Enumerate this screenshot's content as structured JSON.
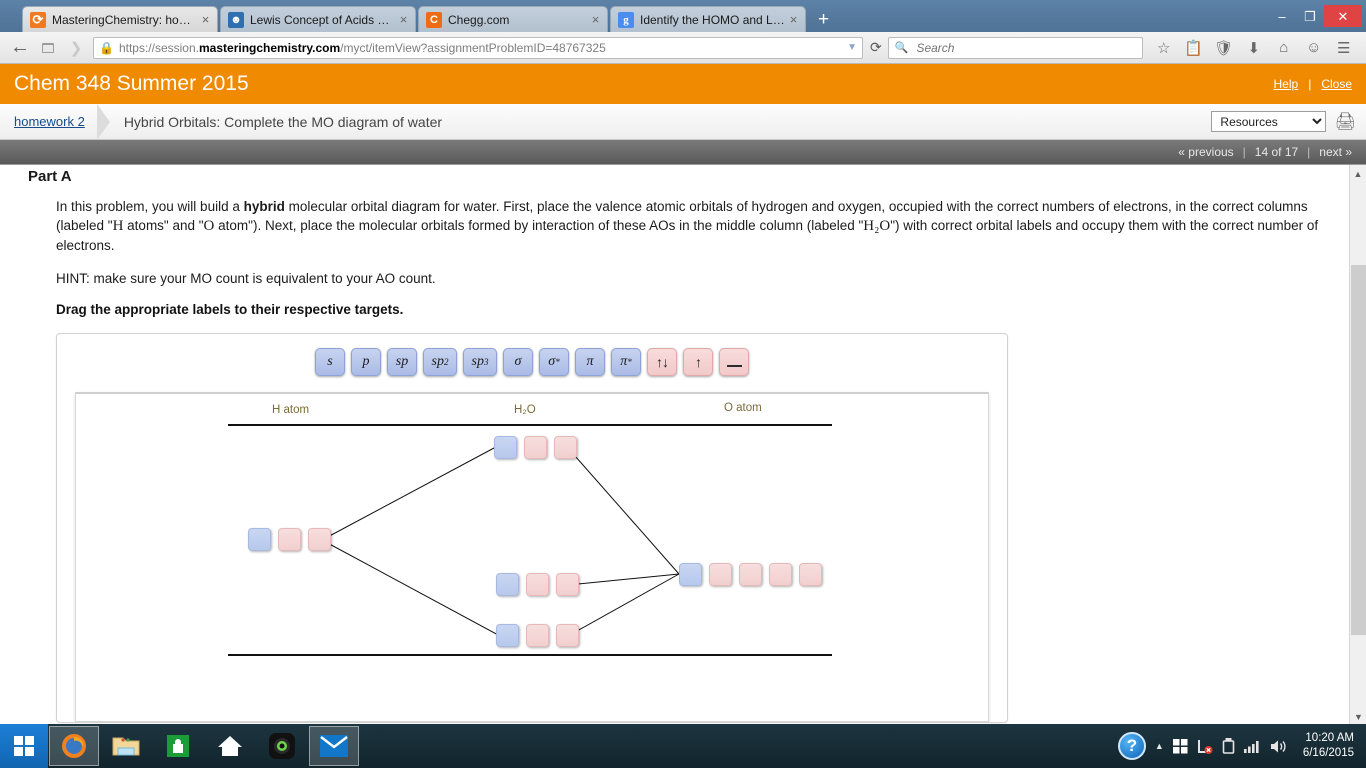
{
  "browser": {
    "tabs": [
      {
        "title": "MasteringChemistry: hom...",
        "favicon": "refresh-circle-icon",
        "active": true
      },
      {
        "title": "Lewis Concept of Acids an...",
        "favicon": "about-person-icon",
        "active": false
      },
      {
        "title": "Chegg.com",
        "favicon": "chegg-c-icon",
        "active": false
      },
      {
        "title": "Identify the HOMO and LU...",
        "favicon": "google-g-icon",
        "active": false
      }
    ],
    "new_tab_label": "+",
    "tab_close_label": "×",
    "window_controls": {
      "minimize": "–",
      "maximize": "❐",
      "close": "✕"
    },
    "url_prefix": "https://session.",
    "url_domain": "masteringchemistry.com",
    "url_suffix": "/myct/itemView?assignmentProblemID=48767325",
    "url_dropdown": "▼",
    "reload": "⟳",
    "back": "←",
    "search_placeholder": "Search",
    "search_value": "",
    "toolbar_icons": [
      "star-icon",
      "reader-list-icon",
      "pocket-shield-icon",
      "downloads-arrow-icon",
      "home-icon",
      "sync-face-icon",
      "hamburger-menu-icon"
    ]
  },
  "course": {
    "title": "Chem 348 Summer 2015",
    "help_label": "Help",
    "separator": "|",
    "close_label": "Close"
  },
  "breadcrumb": {
    "parent": "homework 2",
    "current": "Hybrid Orbitals: Complete the MO diagram of water",
    "resources_selected": "Resources",
    "resources_options": [
      "Resources"
    ],
    "print_icon": "printer-icon"
  },
  "pager": {
    "previous": "« previous",
    "position": "14 of 17",
    "next": "next »",
    "sep": "|"
  },
  "problem": {
    "part_title": "Part A",
    "para1_a": "In this problem, you will build a ",
    "para1_bold": "hybrid",
    "para1_b": " molecular orbital diagram for water. First, place the valence atomic orbitals of hydrogen and oxygen, occupied with the correct numbers of electrons, in the correct columns (labeled \"",
    "para1_H": "H",
    "para1_c": " atoms\" and \"",
    "para1_O": "O",
    "para1_d": " atom\"). Next, place the molecular orbitals formed by interaction of these AOs in the middle column (labeled \"",
    "para1_H2O": "H₂O",
    "para1_e": "\") with correct orbital labels and occupy them with the correct number of electrons.",
    "hint": "HINT: make sure your MO count is equivalent to your AO count.",
    "instruction": "Drag the appropriate labels to their respective targets."
  },
  "label_tray": {
    "chips": [
      {
        "text": "s",
        "sup": "",
        "color": "blue",
        "name": "label-chip-s"
      },
      {
        "text": "p",
        "sup": "",
        "color": "blue",
        "name": "label-chip-p"
      },
      {
        "text": "sp",
        "sup": "",
        "color": "blue",
        "name": "label-chip-sp"
      },
      {
        "text": "sp",
        "sup": "2",
        "color": "blue",
        "name": "label-chip-sp2"
      },
      {
        "text": "sp",
        "sup": "3",
        "color": "blue",
        "name": "label-chip-sp3"
      },
      {
        "text": "σ",
        "sup": "",
        "color": "blue",
        "name": "label-chip-sigma"
      },
      {
        "text": "σ",
        "sup": "*",
        "color": "blue",
        "name": "label-chip-sigma-star"
      },
      {
        "text": "π",
        "sup": "",
        "color": "blue",
        "name": "label-chip-pi"
      },
      {
        "text": "π",
        "sup": "*",
        "color": "blue",
        "name": "label-chip-pi-star"
      },
      {
        "text": "↑↓",
        "sup": "",
        "color": "pink",
        "name": "label-chip-paired-electrons"
      },
      {
        "text": "↑",
        "sup": "",
        "color": "pink",
        "name": "label-chip-single-electron"
      },
      {
        "text": "___",
        "sup": "",
        "color": "pink",
        "name": "label-chip-empty-orbital"
      }
    ]
  },
  "diagram": {
    "col_h": "H atom",
    "col_center": "H₂O",
    "col_o": "O atom",
    "rows": [
      {
        "name": "h-atom-row",
        "slots": [
          "blue",
          "pink",
          "pink"
        ]
      },
      {
        "name": "mo-antibonding-row",
        "slots": [
          "blue",
          "pink",
          "pink"
        ]
      },
      {
        "name": "mo-nonbonding-row",
        "slots": [
          "blue",
          "pink",
          "pink"
        ]
      },
      {
        "name": "mo-bonding-row",
        "slots": [
          "blue",
          "pink",
          "pink"
        ]
      },
      {
        "name": "o-atom-row",
        "slots": [
          "blue",
          "pink",
          "pink",
          "pink",
          "pink"
        ]
      }
    ]
  },
  "scrollbar": {
    "up": "▲",
    "down": "▼"
  },
  "taskbar": {
    "start_label": "start-windows-icon",
    "items": [
      {
        "name": "taskbar-firefox",
        "icon": "firefox-icon",
        "active": true
      },
      {
        "name": "taskbar-file-explorer",
        "icon": "folder-icon",
        "active": false
      },
      {
        "name": "taskbar-store",
        "icon": "store-bag-icon",
        "active": false
      },
      {
        "name": "taskbar-home",
        "icon": "house-icon",
        "active": false
      },
      {
        "name": "taskbar-camera",
        "icon": "camera-lens-icon",
        "active": false
      },
      {
        "name": "taskbar-mail",
        "icon": "envelope-icon",
        "active": true
      }
    ],
    "tray": {
      "help": "?",
      "chevron": "▲",
      "icons": [
        "windows-flag-icon",
        "network-error-icon",
        "battery-icon",
        "signal-bars-icon",
        "volume-icon"
      ],
      "time": "10:20 AM",
      "date": "6/16/2015"
    }
  }
}
